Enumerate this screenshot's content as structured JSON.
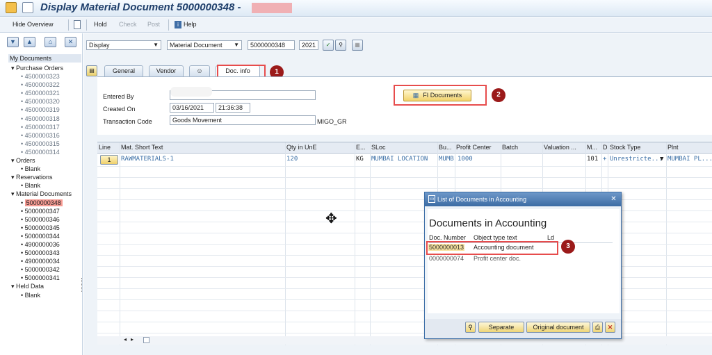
{
  "window": {
    "title": "Display Material Document 5000000348 -"
  },
  "toolbar": {
    "hide_overview": "Hide Overview",
    "hold": "Hold",
    "check": "Check",
    "post": "Post",
    "help": "Help"
  },
  "criteria": {
    "action": "Display",
    "reference": "Material Document",
    "doc_number": "5000000348",
    "year": "2021"
  },
  "tree": {
    "header": "My Documents",
    "items": [
      {
        "text": "Purchase Orders",
        "level": 0
      },
      {
        "text": "4500000323",
        "level": 1
      },
      {
        "text": "4500000322",
        "level": 1
      },
      {
        "text": "4500000321",
        "level": 1
      },
      {
        "text": "4500000320",
        "level": 1
      },
      {
        "text": "4500000319",
        "level": 1
      },
      {
        "text": "4500000318",
        "level": 1
      },
      {
        "text": "4500000317",
        "level": 1
      },
      {
        "text": "4500000316",
        "level": 1
      },
      {
        "text": "4500000315",
        "level": 1
      },
      {
        "text": "4500000314",
        "level": 1
      },
      {
        "text": "Orders",
        "level": 0
      },
      {
        "text": "Blank",
        "level": 2
      },
      {
        "text": "Reservations",
        "level": 0
      },
      {
        "text": "Blank",
        "level": 2
      },
      {
        "text": "Material Documents",
        "level": 0
      },
      {
        "text": "5000000348",
        "level": 2,
        "selected": true
      },
      {
        "text": "5000000347",
        "level": 2
      },
      {
        "text": "5000000346",
        "level": 2
      },
      {
        "text": "5000000345",
        "level": 2
      },
      {
        "text": "5000000344",
        "level": 2
      },
      {
        "text": "4900000036",
        "level": 2
      },
      {
        "text": "5000000343",
        "level": 2
      },
      {
        "text": "4900000034",
        "level": 2
      },
      {
        "text": "5000000342",
        "level": 2
      },
      {
        "text": "5000000341",
        "level": 2
      },
      {
        "text": "Held Data",
        "level": 0
      },
      {
        "text": "Blank",
        "level": 2
      }
    ]
  },
  "tabs": {
    "general": "General",
    "vendor": "Vendor",
    "doc_info": "Doc. info"
  },
  "doc_info": {
    "entered_by_label": "Entered By",
    "created_on_label": "Created On",
    "created_date": "03/16/2021",
    "created_time": "21:36:38",
    "tcode_label": "Transaction Code",
    "tcode_text": "Goods Movement",
    "tcode": "MIGO_GR",
    "fi_button": "FI Documents"
  },
  "badges": [
    "1",
    "2",
    "3"
  ],
  "grid": {
    "headers": [
      "Line",
      "Mat. Short Text",
      "Qty in UnE",
      "E...",
      "SLoc",
      "Bu...",
      "Profit Center",
      "Batch",
      "Valuation ...",
      "M...",
      "D",
      "Stock Type",
      "Plnt"
    ],
    "row": {
      "line": "1",
      "material": "RAWMATERIALS-1",
      "qty": "120",
      "unit": "KG",
      "sloc": "MUMBAI LOCATION",
      "bu": "MUMB",
      "profit_center": "1000",
      "mvt": "101",
      "d": "+",
      "stock_type": "Unrestricte...",
      "plant": "MUMBAI PL..."
    }
  },
  "popup": {
    "title": "List of Documents in Accounting",
    "heading": "Documents in Accounting",
    "col_docnum": "Doc. Number",
    "col_objtype": "Object type text",
    "col_ld": "Ld",
    "rows": [
      {
        "doc": "5000000013",
        "text": "Accounting document"
      },
      {
        "doc": "0000000074",
        "text": "Profit center doc."
      }
    ],
    "separate": "Separate",
    "original": "Original document"
  }
}
